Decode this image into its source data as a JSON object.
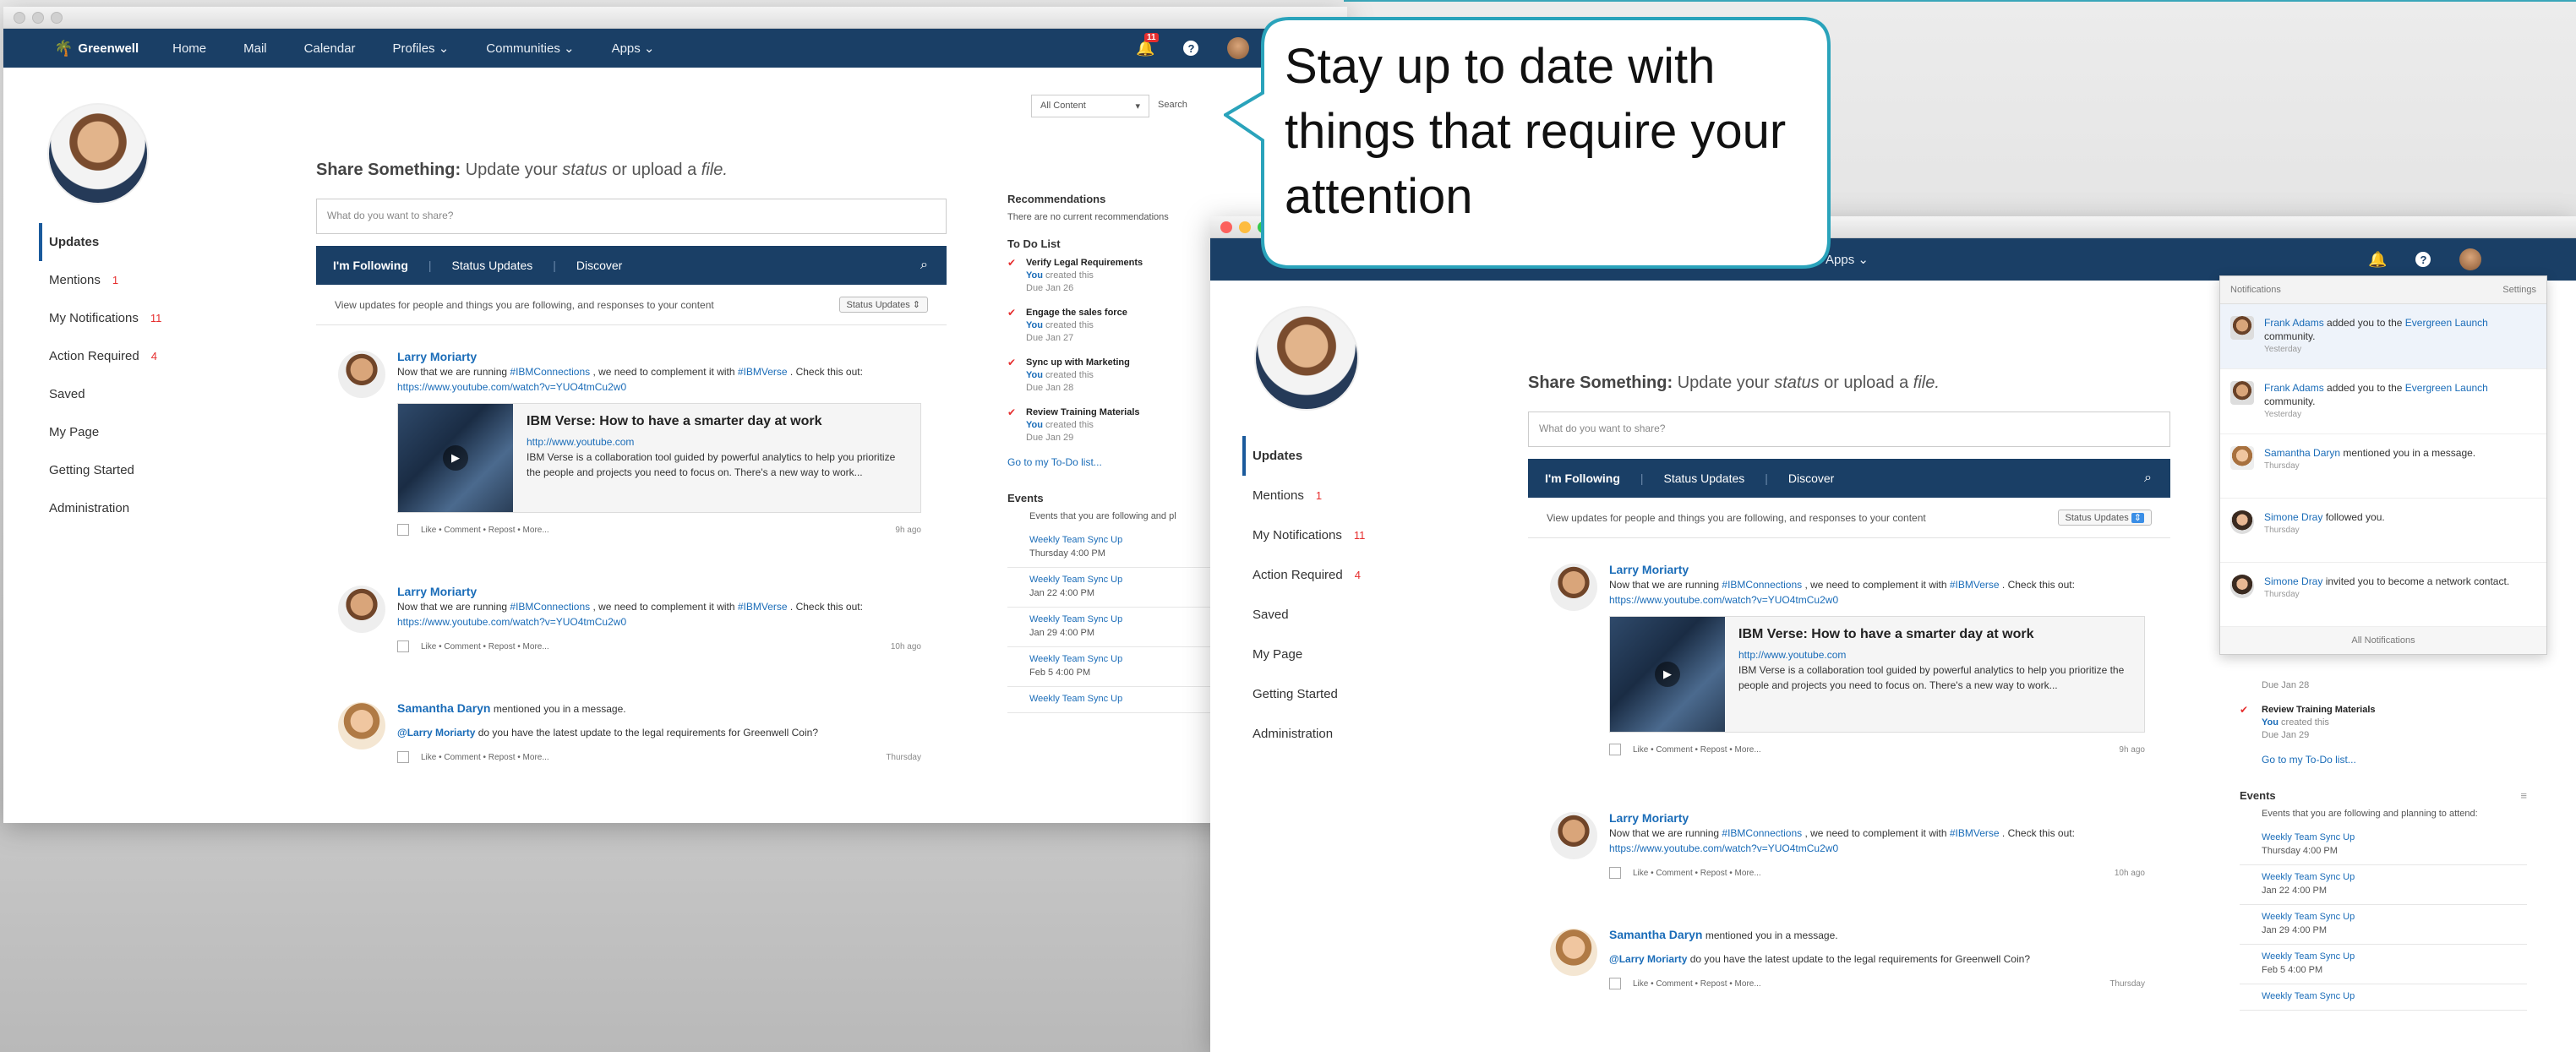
{
  "app": {
    "logo": "Greenwell",
    "nav": [
      "Home",
      "Mail",
      "Calendar",
      "Profiles ⌄",
      "Communities ⌄",
      "Apps ⌄"
    ],
    "notification_count": "11",
    "apps_item": "Apps ⌄"
  },
  "callout": {
    "text": "Stay up to date with things that require your attention"
  },
  "sidebar": {
    "items": [
      {
        "label": "Updates",
        "count": ""
      },
      {
        "label": "Mentions",
        "count": "1"
      },
      {
        "label": "My Notifications",
        "count": "11"
      },
      {
        "label": "Action Required",
        "count": "4"
      },
      {
        "label": "Saved",
        "count": ""
      },
      {
        "label": "My Page",
        "count": ""
      },
      {
        "label": "Getting Started",
        "count": ""
      },
      {
        "label": "Administration",
        "count": ""
      }
    ]
  },
  "share": {
    "prefix": "Share Something:",
    "mid": " Update your ",
    "status": "status",
    "or": " or upload a ",
    "file": "file.",
    "placeholder": "What do you want to share?"
  },
  "filter": {
    "following": "I'm Following",
    "status_updates": "Status Updates",
    "discover": "Discover",
    "view_text": "View updates for people and things you are following, and responses to your content",
    "dropdown": "Status Updates"
  },
  "search": {
    "scope": "All Content",
    "placeholder": "Search"
  },
  "posts": [
    {
      "author": "Larry Moriarty",
      "text1": "Now that we are running ",
      "tag1": "#IBMConnections",
      "text2": " , we need to complement it with ",
      "tag2": "#IBMVerse",
      "text3": " . Check this out: ",
      "url": "https://www.youtube.com/watch?v=YUO4tmCu2w0",
      "embed_title": "IBM Verse: How to have a smarter day at work",
      "embed_url": "http://www.youtube.com",
      "embed_desc": "IBM Verse is a collaboration tool guided by powerful analytics to help you prioritize the people and projects you need to focus on. There's a new way to work...",
      "actions": "Like • Comment • Repost • More...",
      "time": "9h ago"
    },
    {
      "author": "Larry Moriarty",
      "text1": "Now that we are running ",
      "tag1": "#IBMConnections",
      "text2": " , we need to complement it with ",
      "tag2": "#IBMVerse",
      "text3": " . Check this out: ",
      "url": "https://www.youtube.com/watch?v=YUO4tmCu2w0",
      "actions": "Like • Comment • Repost • More...",
      "time": "10h ago"
    },
    {
      "author": "Samantha Daryn",
      "action": " mentioned you in a message.",
      "mention": "@Larry Moriarty",
      "text": " do you have the latest update to the legal requirements for Greenwell Coin?",
      "actions": "Like • Comment • Repost • More...",
      "time": "Thursday"
    }
  ],
  "recommendations": {
    "title": "Recommendations",
    "text": "There are no current recommendations"
  },
  "todo": {
    "title": "To Do List",
    "items": [
      {
        "title": "Verify Legal Requirements",
        "who": "You",
        "action": " created this",
        "due": "Due Jan 26"
      },
      {
        "title": "Engage the sales force",
        "who": "You",
        "action": " created this",
        "due": "Due Jan 27"
      },
      {
        "title": "Sync up with Marketing",
        "who": "You",
        "action": " created this",
        "due": "Due Jan 28"
      },
      {
        "title": "Review Training Materials",
        "who": "You",
        "action": " created this",
        "due": "Due Jan 29"
      }
    ],
    "link": "Go to my To-Do list...",
    "due_partial": "Due Jan 28"
  },
  "events": {
    "title": "Events",
    "text_short": "Events that you are following and pl",
    "text": "Events that you are following and planning to attend:",
    "items": [
      {
        "title": "Weekly Team Sync Up",
        "date": "Thursday 4:00 PM"
      },
      {
        "title": "Weekly Team Sync Up",
        "date": "Jan 22 4:00 PM"
      },
      {
        "title": "Weekly Team Sync Up",
        "date": "Jan 29 4:00 PM"
      },
      {
        "title": "Weekly Team Sync Up",
        "date": "Feb 5 4:00 PM"
      },
      {
        "title": "Weekly Team Sync Up",
        "date": ""
      }
    ]
  },
  "notifications": {
    "title": "Notifications",
    "settings": "Settings",
    "items": [
      {
        "who": "Frank Adams",
        "text": " added you to the ",
        "target": "Evergreen Launch",
        "rest": " community.",
        "time": "Yesterday"
      },
      {
        "who": "Frank Adams",
        "text": " added you to the ",
        "target": "Evergreen Launch",
        "rest": " community.",
        "time": "Yesterday"
      },
      {
        "who": "Samantha Daryn",
        "text": " mentioned you in a message.",
        "target": "",
        "rest": "",
        "time": "Thursday"
      },
      {
        "who": "Simone Dray",
        "text": " followed you.",
        "target": "",
        "rest": "",
        "time": "Thursday"
      },
      {
        "who": "Simone Dray",
        "text": " invited you to become a network contact.",
        "target": "",
        "rest": "",
        "time": "Thursday"
      }
    ],
    "footer": "All Notifications"
  },
  "colors": {
    "navbar": "#1a3f66",
    "link": "#1a6cb8",
    "badge": "#e62e2e",
    "callout_border": "#2aa3bb"
  }
}
